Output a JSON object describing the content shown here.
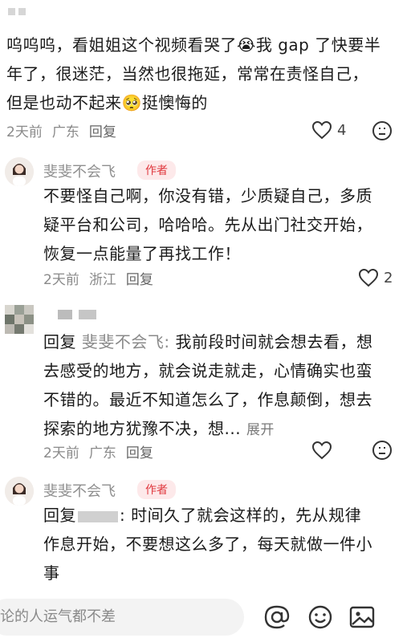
{
  "comment1": {
    "text": "呜呜呜，看姐姐这个视频看哭了😭我 gap 了快要半年了，很迷茫，当然也很拖延，常常在责怪自己，但是也动不起来🥺挺懊悔的",
    "line1": "呜呜呜，看姐姐这个视频看哭了",
    "line1b": "我 gap 了快要半",
    "line2": "年了，很迷茫，当然也很拖延，常常在责怪自己，",
    "line3a": "但是也动不起来",
    "line3b": "挺懊悔的",
    "time": "2天前",
    "location": "广东",
    "reply_label": "回复",
    "likes": "4"
  },
  "reply1": {
    "author": "斐斐不会飞",
    "badge": "作者",
    "line1": "不要怪自己啊，你没有错，少质疑自己，多质",
    "line2": "疑平台和公司，哈哈哈。先从出门社交开始，",
    "line3": "恢复一点能量了再找工作！",
    "time": "2天前",
    "location": "浙江",
    "reply_label": "回复",
    "likes": "2"
  },
  "reply2": {
    "reply_prefix": "回复",
    "reply_target": "斐斐不会飞:",
    "line1": "我前段时间就会想去看，想",
    "line2": "去感受的地方，就会说走就走，心情确实也蛮",
    "line3": "不错的。最近不知道怎么了，作息颠倒，想去",
    "line4": "探索的地方犹豫不决，想...",
    "expand": "展开",
    "time": "2天前",
    "location": "广东",
    "reply_label": "回复"
  },
  "reply3": {
    "author": "斐斐不会飞",
    "badge": "作者",
    "reply_prefix": "回复",
    "line1": ": 时间久了就会这样的，先从规律",
    "line2": "作息开始，不要想这么多了，每天就做一件小",
    "line3": "事"
  },
  "bottom_bar": {
    "placeholder": "论的人运气都不差"
  },
  "icons": {
    "like": "heart-outline-icon",
    "emoji": "emoji-face-icon",
    "at": "at-sign-icon",
    "image": "image-icon"
  },
  "colors": {
    "badge_text": "#e0383e",
    "badge_bg": "#fde9ea",
    "meta_gray": "#8a8a8a"
  }
}
